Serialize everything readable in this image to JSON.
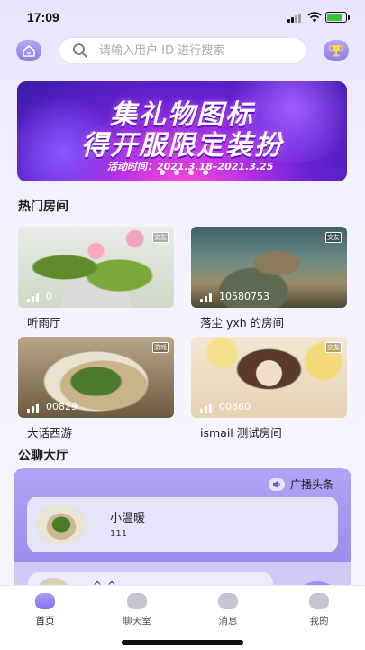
{
  "status_bar": {
    "time": "17:09"
  },
  "search": {
    "placeholder": "请输入用户 ID 进行搜索"
  },
  "banner": {
    "title_line1": "集礼物图标",
    "title_line2": "得开服限定装扮",
    "date_text": "活动时间：2021.3.18–2021.3.25",
    "slide_count": 4
  },
  "hot_rooms": {
    "title": "热门房间",
    "rooms": [
      {
        "name": "听雨厅",
        "count": "0",
        "tag": "交友"
      },
      {
        "name": "落尘 yxh 的房间",
        "count": "10580753",
        "tag": "交友"
      },
      {
        "name": "大话西游",
        "count": "00829",
        "tag": "游戏"
      },
      {
        "name": "ismail 测试房间",
        "count": "00860",
        "tag": "交友"
      }
    ]
  },
  "public_hall": {
    "title": "公聊大厅",
    "broadcast_label": "广播头条",
    "messages": [
      {
        "name": "小温暖",
        "text": "111"
      },
      {
        "name": "^_^",
        "text": ""
      }
    ]
  },
  "tabbar": {
    "tabs": [
      {
        "label": "首页",
        "active": true
      },
      {
        "label": "聊天室",
        "active": false
      },
      {
        "label": "消息",
        "active": false
      },
      {
        "label": "我的",
        "active": false
      }
    ]
  }
}
